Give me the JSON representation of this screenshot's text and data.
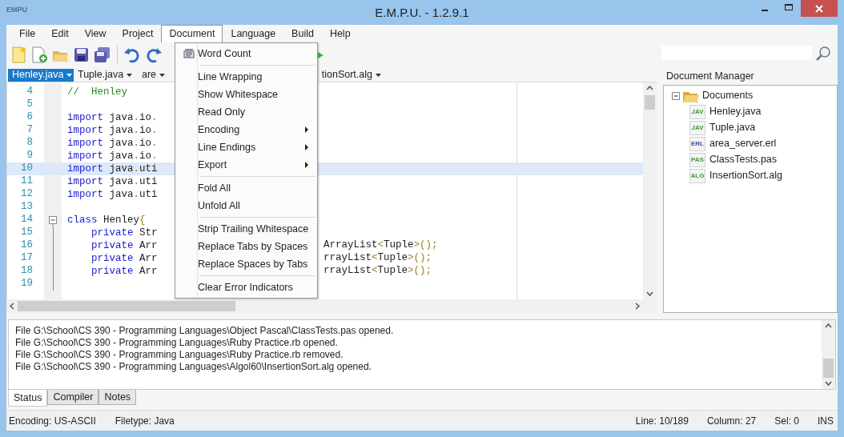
{
  "window": {
    "logo": "EMPU",
    "title": "E.M.P.U. - 1.2.9.1"
  },
  "menubar": [
    {
      "label": "File",
      "selected": false
    },
    {
      "label": "Edit",
      "selected": false
    },
    {
      "label": "View",
      "selected": false
    },
    {
      "label": "Project",
      "selected": false
    },
    {
      "label": "Document",
      "selected": true
    },
    {
      "label": "Language",
      "selected": false
    },
    {
      "label": "Build",
      "selected": false
    },
    {
      "label": "Help",
      "selected": false
    }
  ],
  "toolbar": {
    "buttons": [
      {
        "kind": "new"
      },
      {
        "kind": "add"
      },
      {
        "kind": "open"
      },
      {
        "kind": "save"
      },
      {
        "kind": "save_all"
      },
      {
        "kind": "separator"
      },
      {
        "kind": "undo"
      },
      {
        "kind": "redo"
      }
    ]
  },
  "doc_tabs": [
    {
      "label": "Henley.java",
      "selected": true
    },
    {
      "label": "Tuple.java",
      "selected": false
    },
    {
      "label": "are",
      "selected": false
    },
    {
      "label": "tionSort.alg",
      "selected": false
    }
  ],
  "editor": {
    "lines": [
      {
        "number": "4",
        "current": false,
        "left": [
          {
            "text": "//  Henley",
            "kind": "comment"
          }
        ]
      },
      {
        "number": "5",
        "current": false
      },
      {
        "number": "6",
        "current": false,
        "left": [
          {
            "text": "import",
            "kind": "keyword"
          },
          {
            "text": " java"
          },
          {
            "text": ".",
            "kind": "punct"
          },
          {
            "text": "io"
          },
          {
            "text": ".",
            "kind": "punct"
          }
        ]
      },
      {
        "number": "7",
        "current": false,
        "left": [
          {
            "text": "import",
            "kind": "keyword"
          },
          {
            "text": " java"
          },
          {
            "text": ".",
            "kind": "punct"
          },
          {
            "text": "io"
          },
          {
            "text": ".",
            "kind": "punct"
          }
        ]
      },
      {
        "number": "8",
        "current": false,
        "left": [
          {
            "text": "import",
            "kind": "keyword"
          },
          {
            "text": " java"
          },
          {
            "text": ".",
            "kind": "punct"
          },
          {
            "text": "io"
          },
          {
            "text": ".",
            "kind": "punct"
          }
        ]
      },
      {
        "number": "9",
        "current": false,
        "left": [
          {
            "text": "import",
            "kind": "keyword"
          },
          {
            "text": " java"
          },
          {
            "text": ".",
            "kind": "punct"
          },
          {
            "text": "io"
          },
          {
            "text": ".",
            "kind": "punct"
          }
        ]
      },
      {
        "number": "10",
        "current": true,
        "left": [
          {
            "text": "import",
            "kind": "keyword"
          },
          {
            "text": " java"
          },
          {
            "text": ".",
            "kind": "punct"
          },
          {
            "text": "uti"
          }
        ]
      },
      {
        "number": "11",
        "current": false,
        "left": [
          {
            "text": "import",
            "kind": "keyword"
          },
          {
            "text": " java"
          },
          {
            "text": ".",
            "kind": "punct"
          },
          {
            "text": "uti"
          }
        ]
      },
      {
        "number": "12",
        "current": false,
        "left": [
          {
            "text": "import",
            "kind": "keyword"
          },
          {
            "text": " java"
          },
          {
            "text": ".",
            "kind": "punct"
          },
          {
            "text": "uti"
          }
        ]
      },
      {
        "number": "13",
        "current": false
      },
      {
        "number": "14",
        "current": false,
        "kind": "fold_start",
        "left": [
          {
            "text": "class",
            "kind": "keyword"
          },
          {
            "text": " Henley"
          },
          {
            "text": "{",
            "kind": "punct"
          }
        ]
      },
      {
        "number": "15",
        "current": false,
        "kind": "fold_body",
        "left": [
          {
            "text": "    private",
            "kind": "keyword"
          },
          {
            "text": " Str"
          }
        ]
      },
      {
        "number": "16",
        "current": false,
        "kind": "fold_body",
        "left": [
          {
            "text": "    private",
            "kind": "keyword"
          },
          {
            "text": " Arr"
          }
        ],
        "right": [
          {
            "text": "ArrayList"
          },
          {
            "text": "<",
            "kind": "punct"
          },
          {
            "text": "Tuple"
          },
          {
            "text": ">();",
            "kind": "punct"
          }
        ]
      },
      {
        "number": "17",
        "current": false,
        "kind": "fold_body",
        "left": [
          {
            "text": "    private",
            "kind": "keyword"
          },
          {
            "text": " Arr"
          }
        ],
        "right": [
          {
            "text": "rrayList"
          },
          {
            "text": "<",
            "kind": "punct"
          },
          {
            "text": "Tuple"
          },
          {
            "text": ">();",
            "kind": "punct"
          }
        ]
      },
      {
        "number": "18",
        "current": false,
        "kind": "fold_body",
        "left": [
          {
            "text": "    private",
            "kind": "keyword"
          },
          {
            "text": " Arr"
          }
        ],
        "right": [
          {
            "text": "rrayList"
          },
          {
            "text": "<",
            "kind": "punct"
          },
          {
            "text": "Tuple"
          },
          {
            "text": ">();",
            "kind": "punct"
          }
        ]
      },
      {
        "number": "19",
        "current": false,
        "kind": "fold_body"
      }
    ]
  },
  "document_menu": [
    {
      "kind": "icon_item",
      "label": "Word Count"
    },
    {
      "kind": "separator"
    },
    {
      "kind": "item",
      "label": "Line Wrapping"
    },
    {
      "kind": "item",
      "label": "Show Whitespace"
    },
    {
      "kind": "item",
      "label": "Read Only"
    },
    {
      "kind": "item",
      "label": "Encoding",
      "submenu": true
    },
    {
      "kind": "item",
      "label": "Line Endings",
      "submenu": true
    },
    {
      "kind": "item",
      "label": "Export",
      "submenu": true
    },
    {
      "kind": "separator"
    },
    {
      "kind": "item",
      "label": "Fold All"
    },
    {
      "kind": "item",
      "label": "Unfold All"
    },
    {
      "kind": "separator"
    },
    {
      "kind": "item",
      "label": "Strip Trailing Whitespace"
    },
    {
      "kind": "item",
      "label": "Replace Tabs by Spaces"
    },
    {
      "kind": "item",
      "label": "Replace Spaces by Tabs"
    },
    {
      "kind": "separator"
    },
    {
      "kind": "item",
      "label": "Clear Error Indicators"
    }
  ],
  "document_manager": {
    "title": "Document Manager",
    "root": {
      "label": "Documents",
      "expanded": true,
      "children": [
        {
          "label": "Henley.java",
          "badge": "JAV",
          "color": "#3a9a3a"
        },
        {
          "label": "Tuple.java",
          "badge": "JAV",
          "color": "#3a9a3a"
        },
        {
          "label": "area_server.erl",
          "badge": "ERL",
          "color": "#3a4fc0"
        },
        {
          "label": "ClassTests.pas",
          "badge": "PAS",
          "color": "#3a9a3a"
        },
        {
          "label": "InsertionSort.alg",
          "badge": "ALG",
          "color": "#3a9a3a"
        }
      ]
    }
  },
  "output": {
    "lines": [
      "File G:\\School\\CS 390 - Programming Languages\\Object Pascal\\ClassTests.pas opened.",
      "File G:\\School\\CS 390 - Programming Languages\\Ruby Practice.rb opened.",
      "File G:\\School\\CS 390 - Programming Languages\\Ruby Practice.rb removed.",
      "File G:\\School\\CS 390 - Programming Languages\\Algol60\\InsertionSort.alg opened."
    ]
  },
  "output_tabs": [
    {
      "label": "Status",
      "selected": true
    },
    {
      "label": "Compiler",
      "selected": false
    },
    {
      "label": "Notes",
      "selected": false
    }
  ],
  "status_bar": {
    "left": [
      "Encoding: US-ASCII",
      "Filetype: Java"
    ],
    "right": [
      "Line: 10/189",
      "Column: 27",
      "Sel: 0",
      "INS"
    ]
  }
}
